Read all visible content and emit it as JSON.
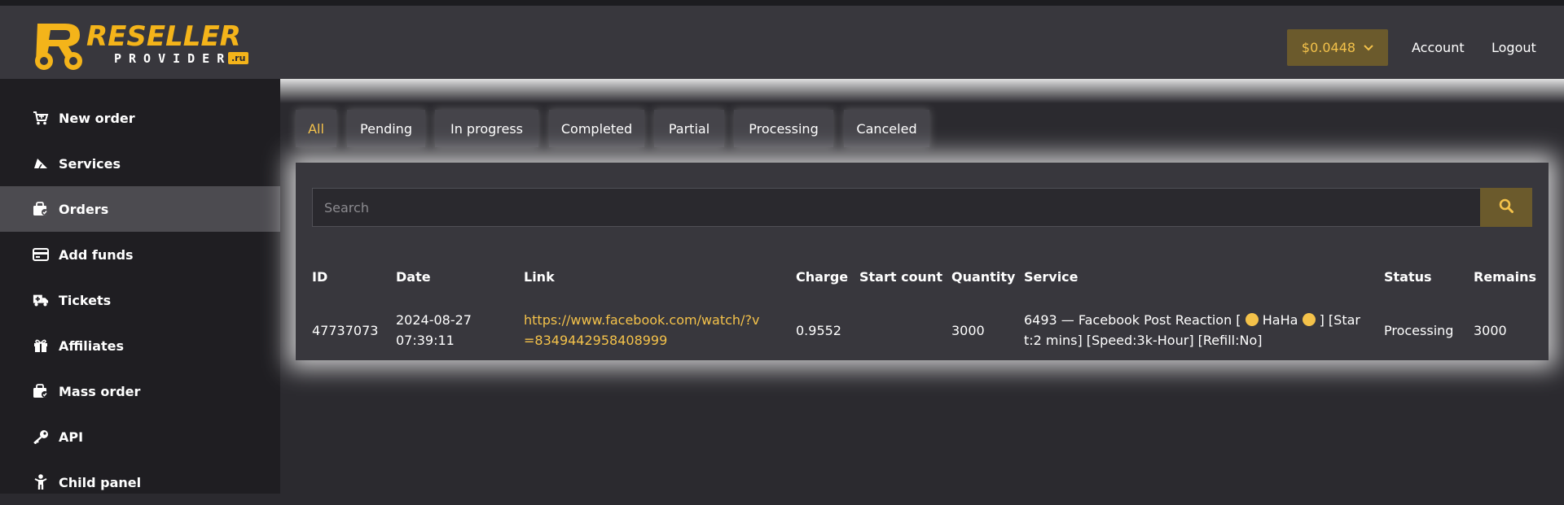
{
  "brand": {
    "name_main": "RESELLER",
    "name_sub": "PROVIDER",
    "tld": ".ru",
    "logo_letters": "RP"
  },
  "header": {
    "balance": "$0.0448",
    "account_label": "Account",
    "logout_label": "Logout"
  },
  "sidebar": {
    "items": [
      {
        "label": "New order",
        "icon": "cart-icon"
      },
      {
        "label": "Services",
        "icon": "paper-plane-icon"
      },
      {
        "label": "Orders",
        "icon": "orders-icon",
        "active": true
      },
      {
        "label": "Add funds",
        "icon": "credit-card-icon"
      },
      {
        "label": "Tickets",
        "icon": "ambulance-icon"
      },
      {
        "label": "Affiliates",
        "icon": "gift-icon"
      },
      {
        "label": "Mass order",
        "icon": "mass-order-icon"
      },
      {
        "label": "API",
        "icon": "key-icon"
      },
      {
        "label": "Child panel",
        "icon": "child-icon"
      }
    ]
  },
  "filters": [
    "All",
    "Pending",
    "In progress",
    "Completed",
    "Partial",
    "Processing",
    "Canceled"
  ],
  "active_filter": "All",
  "search": {
    "placeholder": "Search"
  },
  "table": {
    "columns": [
      "ID",
      "Date",
      "Link",
      "Charge",
      "Start count",
      "Quantity",
      "Service",
      "Status",
      "Remains"
    ],
    "rows": [
      {
        "id": "47737073",
        "date_line1": "2024-08-27",
        "date_line2": "07:39:11",
        "link_line1": "https://www.facebook.com/watch/?v",
        "link_line2": "=8349442958408999",
        "charge": "0.9552",
        "start_count": "",
        "quantity": "3000",
        "service_line1_a": "6493 — Facebook Post Reaction [",
        "service_line1_b": "HaHa",
        "service_line1_c": "] [Star",
        "service_line2": "t:2 mins] [Speed:3k-Hour] [Refill:No]",
        "status": "Processing",
        "remains": "3000"
      }
    ]
  },
  "colors": {
    "accent": "#f4c24a",
    "accent_bg": "#6b5a2c",
    "header_bg": "#38373d",
    "sidebar_bg": "#1f1e22",
    "sidebar_active_bg": "#4c4b50",
    "page_bg": "#2b2a2f"
  }
}
